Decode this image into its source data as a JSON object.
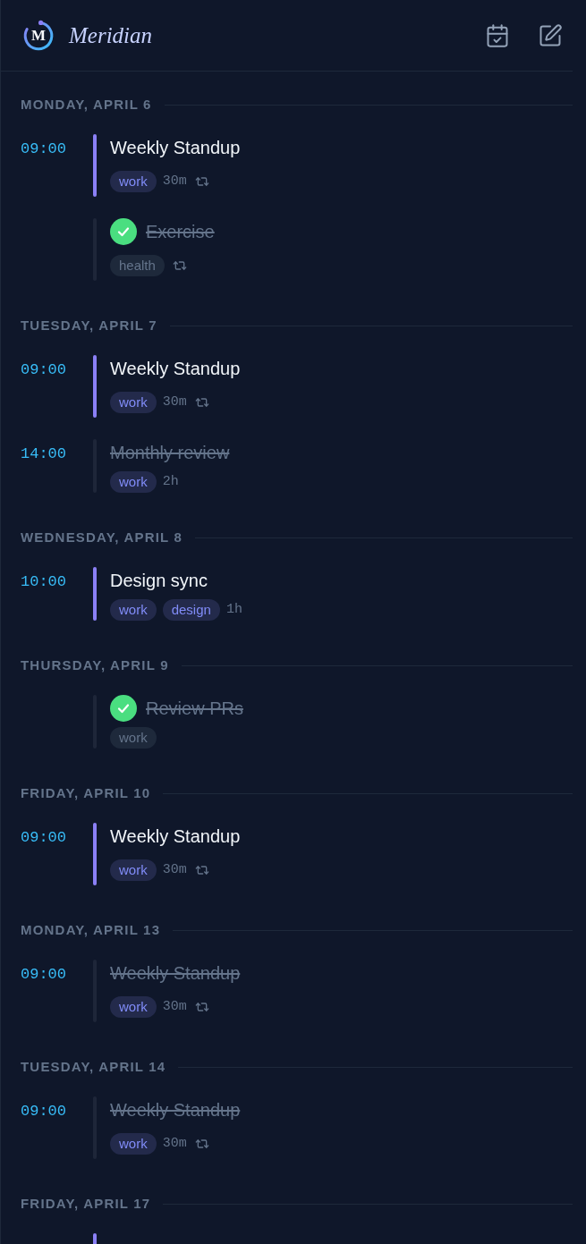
{
  "header": {
    "logo_letter": "M",
    "app_name": "Meridian"
  },
  "days": [
    {
      "label": "MONDAY, APRIL 6",
      "items": [
        {
          "kind": "event",
          "time": "09:00",
          "title": "Weekly Standup",
          "done": false,
          "tags": [
            "work"
          ],
          "duration": "30m",
          "repeats": true
        },
        {
          "kind": "task",
          "title": "Exercise",
          "done": true,
          "tags": [
            "health"
          ],
          "repeats": true
        }
      ]
    },
    {
      "label": "TUESDAY, APRIL 7",
      "items": [
        {
          "kind": "event",
          "time": "09:00",
          "title": "Weekly Standup",
          "done": false,
          "tags": [
            "work"
          ],
          "duration": "30m",
          "repeats": true
        },
        {
          "kind": "event",
          "time": "14:00",
          "title": "Monthly review",
          "done": true,
          "tags": [
            "work"
          ],
          "duration": "2h"
        }
      ]
    },
    {
      "label": "WEDNESDAY, APRIL 8",
      "items": [
        {
          "kind": "event",
          "time": "10:00",
          "title": "Design sync",
          "done": false,
          "tags": [
            "work",
            "design"
          ],
          "duration": "1h"
        }
      ]
    },
    {
      "label": "THURSDAY, APRIL 9",
      "items": [
        {
          "kind": "task",
          "title": "Review PRs",
          "done": true,
          "tags": [
            "work"
          ]
        }
      ]
    },
    {
      "label": "FRIDAY, APRIL 10",
      "items": [
        {
          "kind": "event",
          "time": "09:00",
          "title": "Weekly Standup",
          "done": false,
          "tags": [
            "work"
          ],
          "duration": "30m",
          "repeats": true
        }
      ]
    },
    {
      "label": "MONDAY, APRIL 13",
      "items": [
        {
          "kind": "event",
          "time": "09:00",
          "title": "Weekly Standup",
          "done": true,
          "tags": [
            "work"
          ],
          "duration": "30m",
          "repeats": true
        }
      ]
    },
    {
      "label": "TUESDAY, APRIL 14",
      "items": [
        {
          "kind": "event",
          "time": "09:00",
          "title": "Weekly Standup",
          "done": true,
          "tags": [
            "work"
          ],
          "duration": "30m",
          "repeats": true
        }
      ]
    },
    {
      "label": "FRIDAY, APRIL 17",
      "items": [
        {
          "kind": "event",
          "done": false
        }
      ]
    }
  ]
}
